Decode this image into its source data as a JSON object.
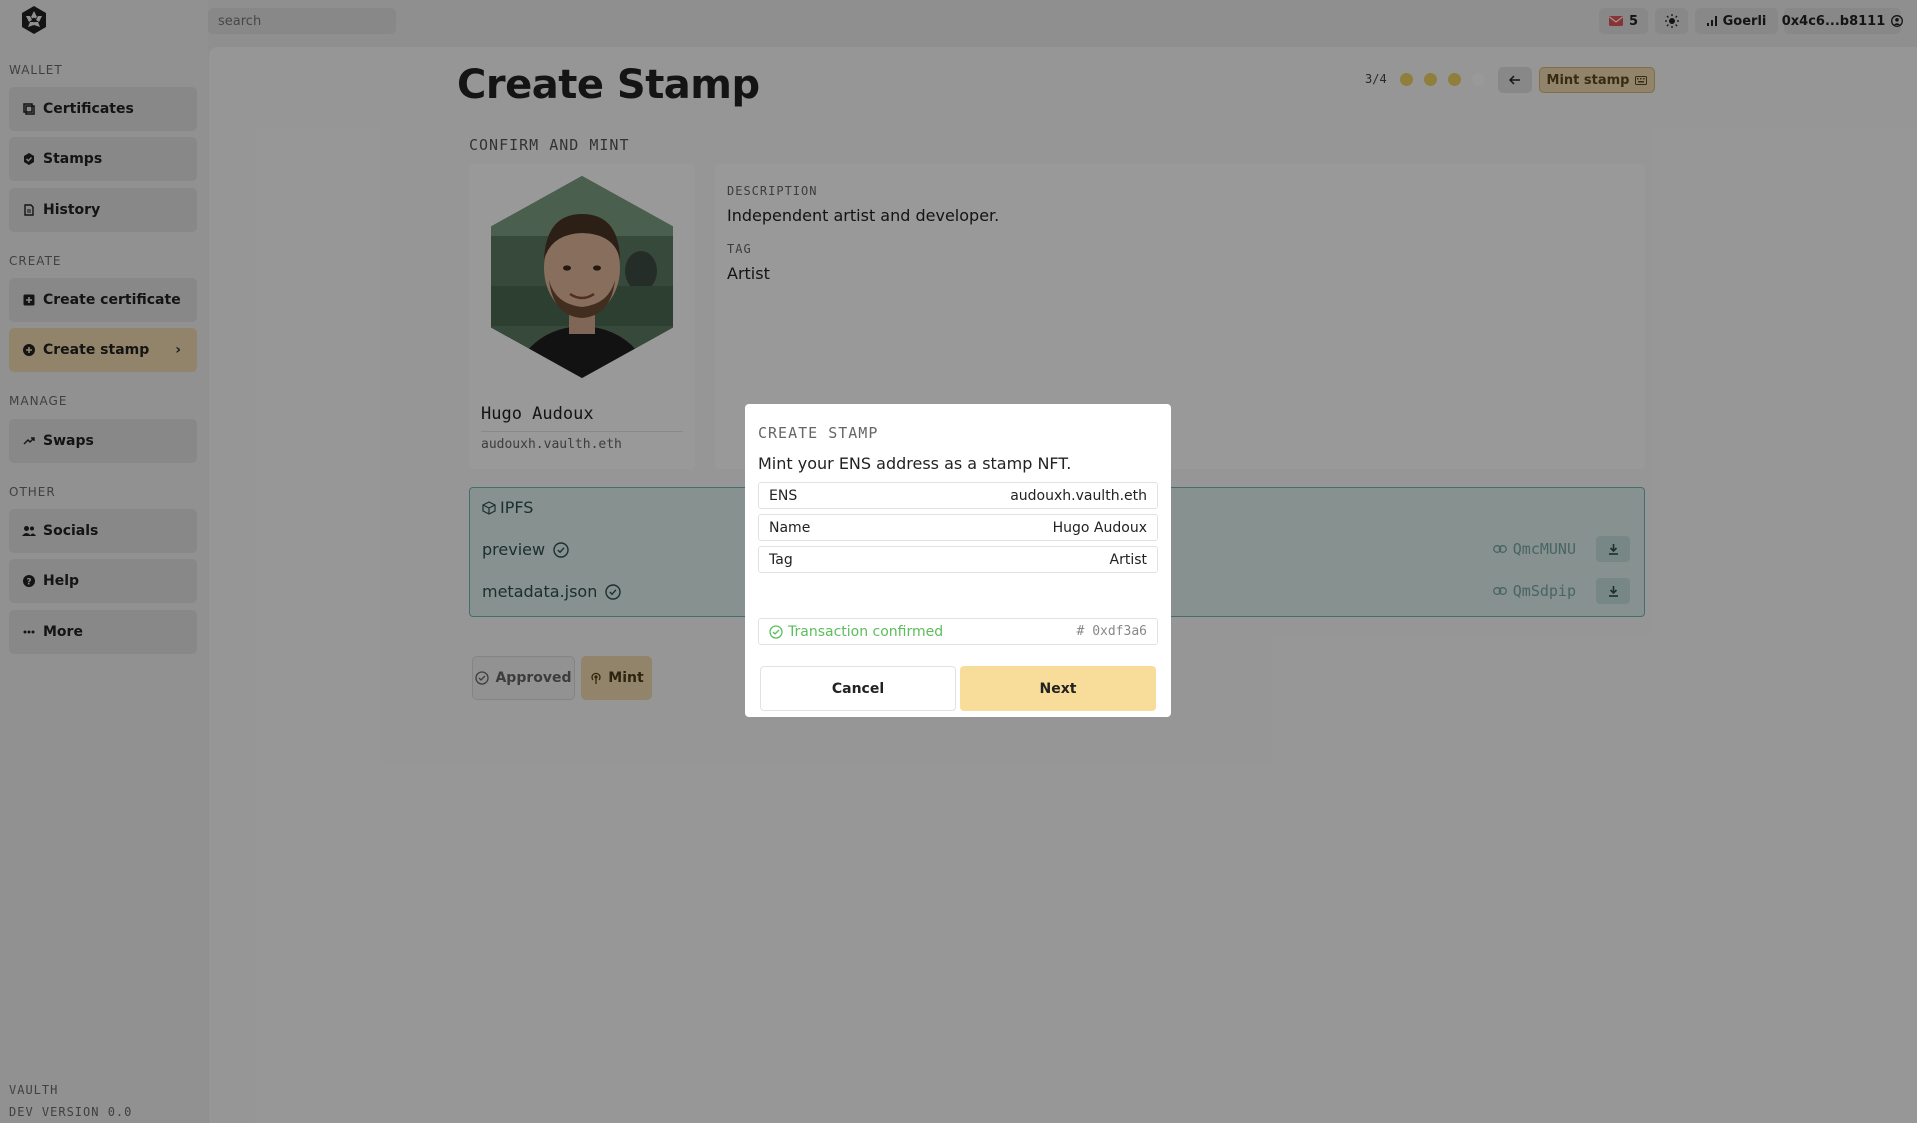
{
  "brand": {
    "logo_icon": "vaulth-logo-icon"
  },
  "search": {
    "placeholder": "search"
  },
  "topbar": {
    "notifications": "5",
    "theme_icon": "sun-icon",
    "network": "Goerli",
    "account": "0x4c6...b8111"
  },
  "sidebar": {
    "sections": {
      "wallet": "WALLET",
      "create": "CREATE",
      "manage": "MANAGE",
      "other": "OTHER"
    },
    "items": [
      {
        "label": "Certificates",
        "icon": "certificates-icon"
      },
      {
        "label": "Stamps",
        "icon": "stamp-icon"
      },
      {
        "label": "History",
        "icon": "history-icon"
      },
      {
        "label": "Create certificate",
        "icon": "plus-square-icon"
      },
      {
        "label": "Create stamp",
        "icon": "plus-circle-icon",
        "chevron": "›"
      },
      {
        "label": "Swaps",
        "icon": "swap-icon"
      },
      {
        "label": "Socials",
        "icon": "users-icon"
      },
      {
        "label": "Help",
        "icon": "help-icon"
      },
      {
        "label": "More",
        "icon": "dots-icon"
      }
    ],
    "footer": {
      "app": "VAULTH",
      "version": "DEV VERSION 0.0"
    }
  },
  "page": {
    "title": "Create Stamp",
    "step": "3/4",
    "steps_done": 3,
    "steps_total": 4,
    "mint_stamp": "Mint stamp",
    "section_label": "CONFIRM AND MINT",
    "profile": {
      "name": "Hugo Audoux",
      "ens": "audouxh.vaulth.eth"
    },
    "description_label": "DESCRIPTION",
    "description": "Independent artist and developer.",
    "tag_label": "TAG",
    "tag": "Artist",
    "ipfs": {
      "title": "IPFS",
      "files": [
        {
          "name": "preview",
          "hash": "QmcMUNU"
        },
        {
          "name": "metadata.json",
          "hash": "QmSdpip"
        }
      ]
    },
    "approved": "Approved",
    "mint": "Mint"
  },
  "modal": {
    "title": "CREATE STAMP",
    "subtitle": "Mint your ENS address as a stamp NFT.",
    "rows": [
      {
        "label": "ENS",
        "value": "audouxh.vaulth.eth"
      },
      {
        "label": "Name",
        "value": "Hugo Audoux"
      },
      {
        "label": "Tag",
        "value": "Artist"
      }
    ],
    "status": "Transaction confirmed",
    "tx": "# 0xdf3a6",
    "cancel": "Cancel",
    "next": "Next"
  },
  "colors": {
    "accent": "#f4ddb2",
    "accent_strong": "#f8dd9a",
    "step_dot_done": "#f0d266",
    "ipfs_bg": "#dff2f1",
    "ipfs_border": "#6fb9b2",
    "success": "#5cbd5c"
  }
}
